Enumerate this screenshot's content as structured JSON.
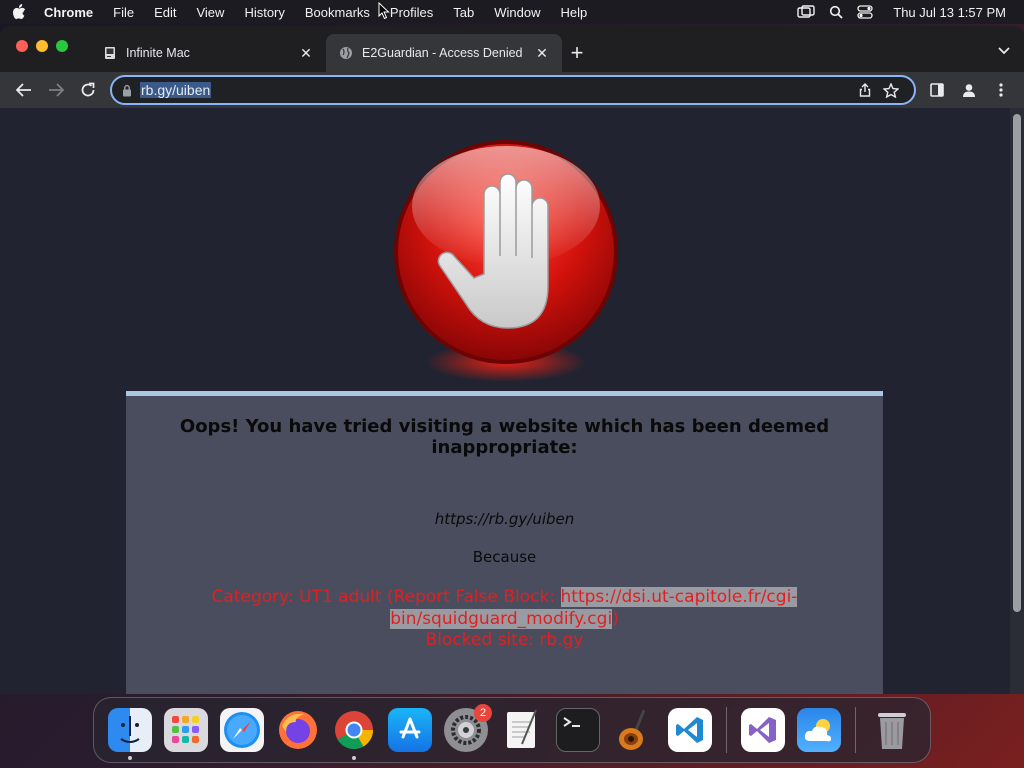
{
  "menubar": {
    "app_name": "Chrome",
    "items": [
      "File",
      "Edit",
      "View",
      "History",
      "Bookmarks",
      "Profiles",
      "Tab",
      "Window",
      "Help"
    ],
    "clock": "Thu Jul 13  1:57 PM"
  },
  "tabs": [
    {
      "title": "Infinite Mac",
      "icon": "mac-icon",
      "active": false
    },
    {
      "title": "E2Guardian - Access Denied",
      "icon": "globe-icon",
      "active": true
    }
  ],
  "toolbar": {
    "url": "rb.gy/uiben"
  },
  "page": {
    "headline": "Oops! You have tried visiting a website which has been deemed inappropriate:",
    "blocked_url": "https://rb.gy/uiben",
    "because": "Because",
    "reason_prefix": "Category: UT1 adult (Report False Block: ",
    "report_link": "https://dsi.ut-capitole.fr/cgi-bin/squidguard_modify.cgi",
    "reason_suffix": ")",
    "blocked_site": "Blocked site: rb.gy"
  },
  "dock": {
    "apps": [
      {
        "name": "Finder",
        "icon": "finder-icon",
        "running": true
      },
      {
        "name": "Launchpad",
        "icon": "launchpad-icon",
        "running": false
      },
      {
        "name": "Safari",
        "icon": "safari-icon",
        "running": false
      },
      {
        "name": "Firefox",
        "icon": "firefox-icon",
        "running": false
      },
      {
        "name": "Chrome",
        "icon": "chrome-icon",
        "running": true
      },
      {
        "name": "App Store",
        "icon": "appstore-icon",
        "running": false
      },
      {
        "name": "System Settings",
        "icon": "settings-icon",
        "running": false,
        "badge": "2"
      },
      {
        "name": "TextEdit",
        "icon": "textedit-icon",
        "running": false
      },
      {
        "name": "Terminal",
        "icon": "terminal-icon",
        "running": false
      },
      {
        "name": "GarageBand",
        "icon": "garageband-icon",
        "running": false
      },
      {
        "name": "VS Code",
        "icon": "vscode-icon",
        "running": false
      }
    ],
    "extras": [
      {
        "name": "Visual Studio",
        "icon": "visualstudio-icon"
      },
      {
        "name": "Weather",
        "icon": "weather-icon"
      }
    ],
    "trash": {
      "name": "Trash",
      "icon": "trash-icon"
    }
  },
  "colors": {
    "panel_bg": "#4a4d5e",
    "panel_top_border": "#a9c8e6",
    "reason_red": "#e02020",
    "page_bg": "#212330"
  }
}
